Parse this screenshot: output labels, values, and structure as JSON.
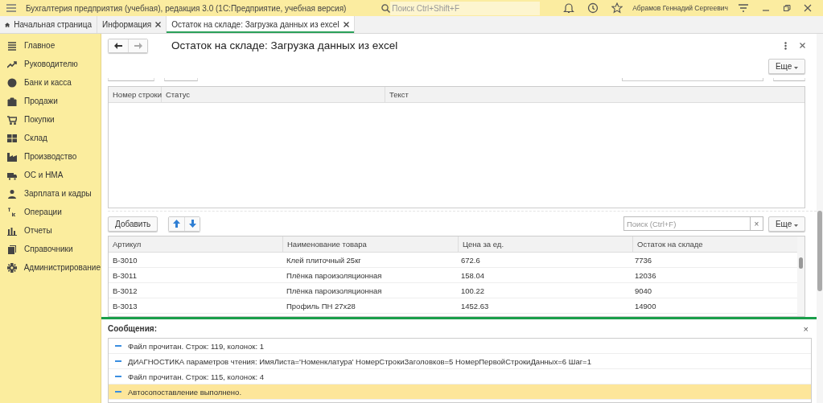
{
  "window": {
    "title": "Бухгалтерия предприятия (учебная), редакция 3.0  (1С:Предприятие, учебная версия)",
    "search_placeholder": "Поиск Ctrl+Shift+F",
    "user": "Абрамов Геннадий Сергеевич"
  },
  "tabs": [
    {
      "label": "Начальная страница",
      "kind": "home",
      "selected": false
    },
    {
      "label": "Информация",
      "kind": "doc",
      "selected": false
    },
    {
      "label": "Остаток на складе: Загрузка данных из excel",
      "kind": "doc",
      "selected": true
    }
  ],
  "sidebar": {
    "items": [
      {
        "label": "Главное",
        "kind": "menu"
      },
      {
        "label": "Руководителю",
        "kind": "trend"
      },
      {
        "label": "Банк и касса",
        "kind": "coin"
      },
      {
        "label": "Продажи",
        "kind": "bag"
      },
      {
        "label": "Покупки",
        "kind": "cart"
      },
      {
        "label": "Склад",
        "kind": "grid"
      },
      {
        "label": "Производство",
        "kind": "factory"
      },
      {
        "label": "ОС и НМА",
        "kind": "truck"
      },
      {
        "label": "Зарплата и кадры",
        "kind": "person"
      },
      {
        "label": "Операции",
        "kind": "dtkt"
      },
      {
        "label": "Отчеты",
        "kind": "bars"
      },
      {
        "label": "Справочники",
        "kind": "books"
      },
      {
        "label": "Администрирование",
        "kind": "gear"
      }
    ]
  },
  "form": {
    "title": "Остаток на складе: Загрузка данных из excel",
    "more": "Еще",
    "status_table": {
      "columns": [
        "Номер строки",
        "Статус",
        "Текст"
      ]
    },
    "toolbar": {
      "add": "Добавить",
      "search_placeholder": "Поиск (Ctrl+F)",
      "clear": "×",
      "more": "Еще"
    },
    "table": {
      "columns": [
        "Артикул",
        "Наименование товара",
        "Цена за ед.",
        "Остаток на складе"
      ],
      "rows": [
        [
          "В-3010",
          "Клей плиточный 25кг",
          "672.6",
          "7736"
        ],
        [
          "В-3011",
          "Плёнка пароизоляционная",
          "158.04",
          "12036"
        ],
        [
          "В-3012",
          "Плёнка пароизоляционная",
          "100.22",
          "9040"
        ],
        [
          "В-3013",
          "Профиль ПН 27х28",
          "1452.63",
          "14900"
        ]
      ]
    }
  },
  "messages": {
    "title": "Сообщения:",
    "close": "×",
    "items": [
      {
        "text": "Файл прочитан. Строк: 119, колонок: 1",
        "selected": false
      },
      {
        "text": "ДИАГНОСТИКА параметров чтения: ИмяЛиста='Номенклатура' НомерСтрокиЗаголовков=5 НомерПервойСтрокиДанных=6 Шаг=1",
        "selected": false
      },
      {
        "text": "Файл прочитан. Строк: 115, колонок: 4",
        "selected": false
      },
      {
        "text": "Автосопоставление выполнено.",
        "selected": true
      }
    ]
  }
}
